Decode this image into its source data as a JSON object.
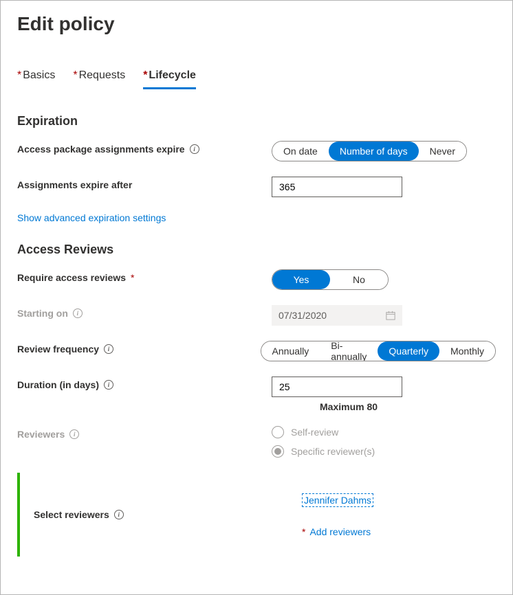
{
  "title": "Edit policy",
  "tabs": {
    "basics": "Basics",
    "requests": "Requests",
    "lifecycle": "Lifecycle"
  },
  "expiration": {
    "heading": "Expiration",
    "assign_expire_label": "Access package assignments expire",
    "opts": {
      "on_date": "On date",
      "num_days": "Number of days",
      "never": "Never"
    },
    "expire_after_label": "Assignments expire after",
    "expire_after_value": "365",
    "advanced_link": "Show advanced expiration settings"
  },
  "reviews": {
    "heading": "Access Reviews",
    "require_label": "Require access reviews",
    "yes": "Yes",
    "no": "No",
    "starting_label": "Starting on",
    "starting_value": "07/31/2020",
    "freq_label": "Review frequency",
    "freq": {
      "annually": "Annually",
      "bi": "Bi-annually",
      "quarterly": "Quarterly",
      "monthly": "Monthly"
    },
    "duration_label": "Duration (in days)",
    "duration_value": "25",
    "duration_hint": "Maximum 80",
    "reviewers_label": "Reviewers",
    "radio_self": "Self-review",
    "radio_specific": "Specific reviewer(s)"
  },
  "select_reviewers": {
    "label": "Select reviewers",
    "selected_name": "Jennifer Dahms",
    "add_label": "Add reviewers"
  }
}
